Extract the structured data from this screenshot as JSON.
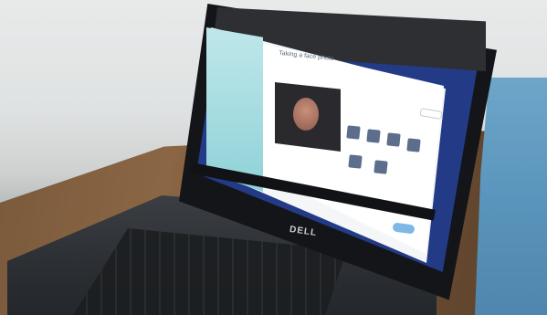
{
  "screen": {
    "window_title": "Taking a face photo",
    "brand": "DELL",
    "captions": {
      "left_panel": "",
      "camera_label": ""
    }
  },
  "colors": {
    "screen_blue": "#233a86",
    "app_accent": "#8ed2d8",
    "button_blue": "#7fb8e6"
  }
}
